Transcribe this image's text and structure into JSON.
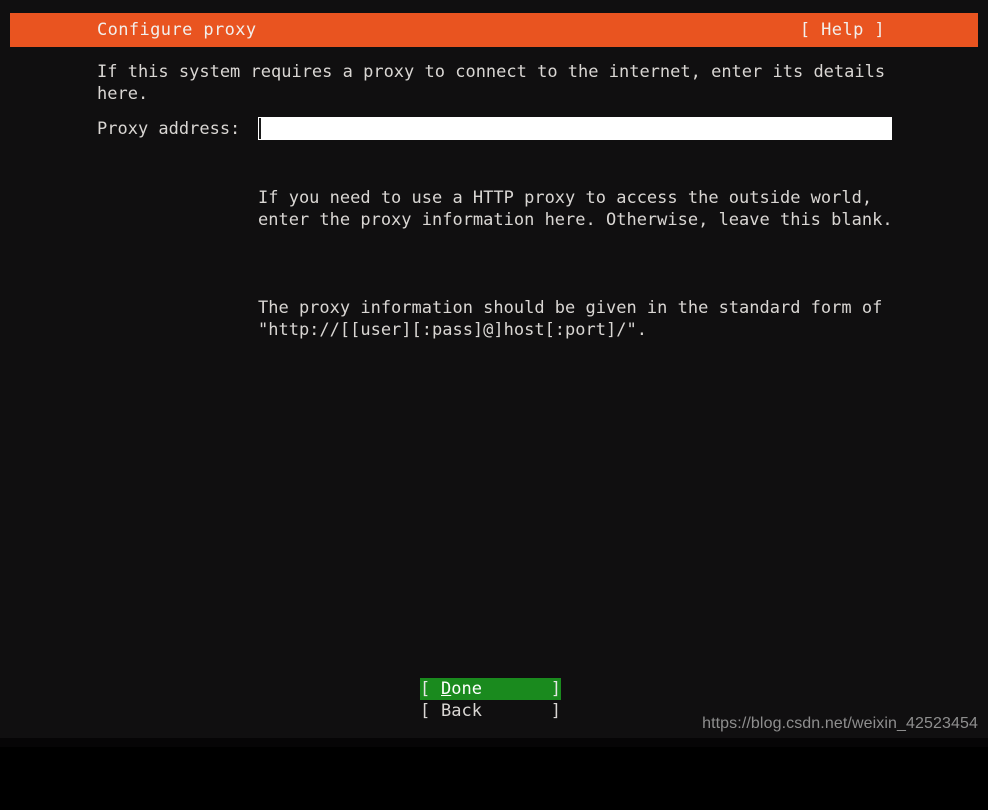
{
  "colors": {
    "background": "#100f10",
    "header_orange": "#e95420",
    "selected_green": "#1a8a1e",
    "text": "#d9d6d3",
    "input_background": "#ffffff",
    "watermark": "#8e8e8e"
  },
  "header": {
    "title": "Configure proxy",
    "help_label": "[ Help ]"
  },
  "main": {
    "intro_text": "If this system requires a proxy to connect to the internet, enter its details here.",
    "field": {
      "label": "Proxy address:",
      "value": "",
      "placeholder": ""
    },
    "hints": [
      "If you need to use a HTTP proxy to access the outside world, enter the proxy information here. Otherwise, leave this blank.",
      "The proxy information should be given in the standard form of \"http://[[user][:pass]@]host[:port]/\"."
    ]
  },
  "buttons": [
    {
      "bracket_left": "[",
      "accel": "D",
      "rest": "one",
      "bracket_right": "]",
      "selected": true
    },
    {
      "bracket_left": "[",
      "accel": "B",
      "rest": "ack",
      "bracket_right": "]",
      "selected": false
    }
  ],
  "watermark": {
    "text": "https://blog.csdn.net/weixin_42523454"
  }
}
